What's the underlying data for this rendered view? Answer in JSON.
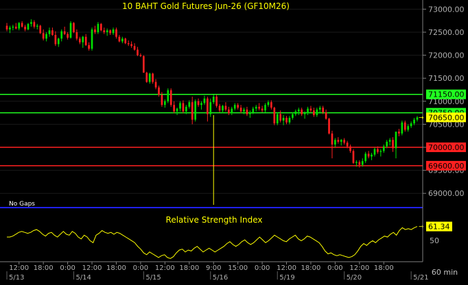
{
  "colors": {
    "background": "#000000",
    "up_candle": "#00e000",
    "down_candle": "#ff2020",
    "title_text": "#ffff00",
    "axis_text": "#b0b0b0",
    "rsi_line": "#ffff00",
    "separator": "#2020ff",
    "support_line": "#ff2020",
    "resistance_line": "#20ff20",
    "marker_line": "#ffff00"
  },
  "chart_data": {
    "type": "candlestick",
    "title": "10 BAHT Gold Futures Jun-26 (GF10M26)",
    "note": "No Gaps",
    "interval_label": "60 min",
    "price_axis": {
      "ylim": [
        68750,
        73080
      ],
      "ticks": [
        69000,
        69500,
        70000,
        70500,
        71000,
        71500,
        72000,
        72500,
        73000
      ],
      "tick_labels": [
        "69000.00",
        "69500.00",
        "70000.00",
        "70500.00",
        "71000.00",
        "71500.00",
        "72000.00",
        "72500.00",
        "73000.00"
      ]
    },
    "x_axis": {
      "time_ticks": [
        {
          "idx": 4,
          "label": "12:00"
        },
        {
          "idx": 12,
          "label": "18:00"
        },
        {
          "idx": 20,
          "label": "0:00"
        },
        {
          "idx": 28,
          "label": "12:00"
        },
        {
          "idx": 36,
          "label": "18:00"
        },
        {
          "idx": 44,
          "label": "0:00"
        },
        {
          "idx": 52,
          "label": "12:00"
        },
        {
          "idx": 60,
          "label": "18:00"
        },
        {
          "idx": 68,
          "label": "9:00"
        },
        {
          "idx": 76,
          "label": "15:00"
        },
        {
          "idx": 84,
          "label": "0:00"
        },
        {
          "idx": 92,
          "label": "12:00"
        },
        {
          "idx": 100,
          "label": "18:00"
        },
        {
          "idx": 108,
          "label": "0:00"
        },
        {
          "idx": 116,
          "label": "12:00"
        },
        {
          "idx": 124,
          "label": "18:00"
        }
      ],
      "date_ticks": [
        {
          "idx": 0,
          "label": "5/13"
        },
        {
          "idx": 22,
          "label": "5/14"
        },
        {
          "idx": 45,
          "label": "5/15"
        },
        {
          "idx": 67,
          "label": "5/16"
        },
        {
          "idx": 89,
          "label": "5/19"
        },
        {
          "idx": 111,
          "label": "5/20"
        },
        {
          "idx": 133,
          "label": "5/21"
        }
      ]
    },
    "horizontal_lines": [
      {
        "value": 71150,
        "label": "71150.00",
        "kind": "resistance"
      },
      {
        "value": 70750,
        "label": "70750.00",
        "kind": "resistance"
      },
      {
        "value": 70000,
        "label": "70000.00",
        "kind": "support"
      },
      {
        "value": 69600,
        "label": "69600.00",
        "kind": "support"
      }
    ],
    "last_price": {
      "value": 70650,
      "label": "70650.00"
    },
    "vertical_marker": {
      "idx": 68,
      "from": 70700,
      "to": 68750
    },
    "candles_ohlc": [
      [
        72640,
        72700,
        72520,
        72560
      ],
      [
        72560,
        72640,
        72480,
        72600
      ],
      [
        72600,
        72660,
        72540,
        72620
      ],
      [
        72620,
        72700,
        72560,
        72580
      ],
      [
        72580,
        72720,
        72540,
        72700
      ],
      [
        72700,
        72740,
        72600,
        72620
      ],
      [
        72620,
        72660,
        72520,
        72560
      ],
      [
        72560,
        72700,
        72540,
        72680
      ],
      [
        72680,
        72780,
        72620,
        72720
      ],
      [
        72720,
        72760,
        72580,
        72620
      ],
      [
        72620,
        72680,
        72560,
        72640
      ],
      [
        72640,
        72660,
        72460,
        72480
      ],
      [
        72480,
        72560,
        72320,
        72360
      ],
      [
        72360,
        72500,
        72300,
        72460
      ],
      [
        72460,
        72600,
        72400,
        72540
      ],
      [
        72540,
        72600,
        72420,
        72440
      ],
      [
        72440,
        72520,
        72200,
        72240
      ],
      [
        72240,
        72380,
        72180,
        72360
      ],
      [
        72360,
        72560,
        72300,
        72520
      ],
      [
        72520,
        72620,
        72440,
        72460
      ],
      [
        72460,
        72500,
        72340,
        72380
      ],
      [
        72380,
        72740,
        72360,
        72700
      ],
      [
        72700,
        72720,
        72480,
        72500
      ],
      [
        72500,
        72560,
        72320,
        72360
      ],
      [
        72360,
        72400,
        72240,
        72280
      ],
      [
        72280,
        72420,
        72160,
        72400
      ],
      [
        72400,
        72460,
        72200,
        72220
      ],
      [
        72220,
        72280,
        72100,
        72140
      ],
      [
        72140,
        72600,
        72100,
        72560
      ],
      [
        72560,
        72640,
        72460,
        72500
      ],
      [
        72500,
        72720,
        72460,
        72680
      ],
      [
        72680,
        72700,
        72520,
        72540
      ],
      [
        72540,
        72600,
        72460,
        72500
      ],
      [
        72500,
        72580,
        72420,
        72540
      ],
      [
        72540,
        72560,
        72440,
        72480
      ],
      [
        72480,
        72600,
        72440,
        72560
      ],
      [
        72560,
        72600,
        72360,
        72400
      ],
      [
        72400,
        72440,
        72280,
        72300
      ],
      [
        72300,
        72400,
        72260,
        72360
      ],
      [
        72360,
        72380,
        72240,
        72260
      ],
      [
        72260,
        72320,
        72200,
        72240
      ],
      [
        72240,
        72300,
        72160,
        72200
      ],
      [
        72200,
        72260,
        72100,
        72120
      ],
      [
        72120,
        72180,
        71980,
        72000
      ],
      [
        72000,
        72040,
        71960,
        71980
      ],
      [
        71980,
        72000,
        71720,
        71620
      ],
      [
        71620,
        71640,
        71400,
        71420
      ],
      [
        71420,
        71620,
        71380,
        71600
      ],
      [
        71600,
        71620,
        71380,
        71420
      ],
      [
        71420,
        71480,
        71260,
        71300
      ],
      [
        71300,
        71340,
        71100,
        71140
      ],
      [
        71140,
        71200,
        70880,
        70920
      ],
      [
        70920,
        71040,
        70860,
        71000
      ],
      [
        71000,
        71280,
        70960,
        71240
      ],
      [
        71240,
        71280,
        70880,
        70920
      ],
      [
        70920,
        71000,
        70740,
        70780
      ],
      [
        70780,
        70860,
        70700,
        70840
      ],
      [
        70840,
        71000,
        70780,
        70960
      ],
      [
        70960,
        71020,
        70740,
        70780
      ],
      [
        70780,
        70920,
        70720,
        70880
      ],
      [
        70880,
        71020,
        70840,
        70980
      ],
      [
        70980,
        71100,
        70500,
        70600
      ],
      [
        70600,
        71040,
        70560,
        71000
      ],
      [
        71000,
        71060,
        70880,
        70920
      ],
      [
        70920,
        71000,
        70820,
        70960
      ],
      [
        70960,
        71120,
        70920,
        71060
      ],
      [
        71060,
        71100,
        70560,
        70720
      ],
      [
        70720,
        71060,
        70660,
        70980
      ],
      [
        70980,
        71140,
        70940,
        71100
      ],
      [
        71100,
        71140,
        70860,
        70900
      ],
      [
        70900,
        70940,
        70760,
        70800
      ],
      [
        70800,
        70920,
        70740,
        70900
      ],
      [
        70900,
        70980,
        70780,
        70820
      ],
      [
        70820,
        70880,
        70700,
        70740
      ],
      [
        70740,
        70880,
        70700,
        70840
      ],
      [
        70840,
        70960,
        70800,
        70920
      ],
      [
        70920,
        70960,
        70820,
        70860
      ],
      [
        70860,
        70920,
        70740,
        70780
      ],
      [
        70780,
        70860,
        70720,
        70820
      ],
      [
        70820,
        70880,
        70680,
        70720
      ],
      [
        70720,
        70800,
        70640,
        70760
      ],
      [
        70760,
        70880,
        70720,
        70840
      ],
      [
        70840,
        70920,
        70780,
        70880
      ],
      [
        70880,
        70960,
        70800,
        70840
      ],
      [
        70840,
        70900,
        70760,
        70800
      ],
      [
        70800,
        70960,
        70760,
        70920
      ],
      [
        70920,
        71020,
        70880,
        70980
      ],
      [
        70980,
        71020,
        70820,
        70860
      ],
      [
        70860,
        70880,
        70480,
        70520
      ],
      [
        70520,
        70760,
        70480,
        70720
      ],
      [
        70720,
        70800,
        70540,
        70580
      ],
      [
        70580,
        70700,
        70480,
        70640
      ],
      [
        70640,
        70680,
        70500,
        70540
      ],
      [
        70540,
        70680,
        70500,
        70640
      ],
      [
        70640,
        70760,
        70600,
        70720
      ],
      [
        70720,
        70820,
        70680,
        70780
      ],
      [
        70780,
        70860,
        70700,
        70820
      ],
      [
        70820,
        70860,
        70680,
        70720
      ],
      [
        70720,
        70780,
        70620,
        70740
      ],
      [
        70740,
        70880,
        70700,
        70840
      ],
      [
        70840,
        70900,
        70760,
        70800
      ],
      [
        70800,
        70860,
        70660,
        70700
      ],
      [
        70700,
        70860,
        70660,
        70820
      ],
      [
        70820,
        70900,
        70760,
        70860
      ],
      [
        70860,
        70900,
        70720,
        70760
      ],
      [
        70760,
        70820,
        70600,
        70620
      ],
      [
        70620,
        70640,
        70280,
        70300
      ],
      [
        70300,
        70360,
        69760,
        70060
      ],
      [
        70060,
        70200,
        70000,
        70160
      ],
      [
        70160,
        70220,
        70080,
        70120
      ],
      [
        70120,
        70180,
        70040,
        70160
      ],
      [
        70160,
        70200,
        70060,
        70100
      ],
      [
        70100,
        70140,
        69980,
        70020
      ],
      [
        70020,
        70060,
        69880,
        69920
      ],
      [
        69920,
        69960,
        69640,
        69660
      ],
      [
        69660,
        69720,
        69580,
        69680
      ],
      [
        69680,
        69720,
        69560,
        69620
      ],
      [
        69620,
        69760,
        69580,
        69700
      ],
      [
        69700,
        69900,
        69660,
        69860
      ],
      [
        69860,
        69920,
        69760,
        69800
      ],
      [
        69800,
        69880,
        69720,
        69840
      ],
      [
        69840,
        70000,
        69800,
        69960
      ],
      [
        69960,
        70020,
        69860,
        69900
      ],
      [
        69900,
        69960,
        69800,
        69920
      ],
      [
        69920,
        70060,
        69880,
        70020
      ],
      [
        70020,
        70160,
        69980,
        70120
      ],
      [
        70120,
        70200,
        70040,
        70160
      ],
      [
        70160,
        70220,
        69900,
        69980
      ],
      [
        69980,
        70020,
        69760,
        70340
      ],
      [
        70340,
        70400,
        70240,
        70300
      ],
      [
        70300,
        70580,
        70260,
        70540
      ],
      [
        70540,
        70580,
        70340,
        70380
      ],
      [
        70380,
        70500,
        70340,
        70460
      ],
      [
        70460,
        70560,
        70420,
        70520
      ],
      [
        70520,
        70640,
        70480,
        70600
      ],
      [
        70600,
        70680,
        70560,
        70650
      ]
    ],
    "rsi": {
      "name": "Relative Strength Index",
      "last": 61.34,
      "last_label": "61.34",
      "level": 50,
      "level_label": "50",
      "ylim": [
        25,
        75
      ],
      "values": [
        50,
        50,
        51,
        53,
        55,
        56,
        55,
        54,
        55,
        57,
        58,
        56,
        53,
        51,
        54,
        55,
        52,
        50,
        53,
        56,
        53,
        52,
        56,
        54,
        50,
        48,
        52,
        50,
        46,
        44,
        52,
        54,
        57,
        55,
        54,
        55,
        53,
        55,
        54,
        52,
        50,
        48,
        46,
        44,
        40,
        37,
        33,
        31,
        34,
        32,
        30,
        28,
        30,
        31,
        28,
        27,
        29,
        33,
        36,
        37,
        34,
        36,
        35,
        38,
        40,
        37,
        34,
        36,
        38,
        36,
        34,
        36,
        38,
        40,
        43,
        45,
        42,
        40,
        42,
        45,
        47,
        44,
        42,
        44,
        47,
        50,
        47,
        44,
        46,
        49,
        52,
        50,
        48,
        46,
        45,
        48,
        50,
        52,
        48,
        46,
        48,
        51,
        50,
        48,
        46,
        44,
        40,
        35,
        32,
        33,
        31,
        30,
        31,
        30,
        29,
        28,
        29,
        31,
        35,
        40,
        43,
        41,
        44,
        46,
        44,
        47,
        49,
        51,
        50,
        53,
        55,
        52,
        57,
        60,
        58,
        59,
        58,
        60,
        61.34
      ]
    }
  }
}
